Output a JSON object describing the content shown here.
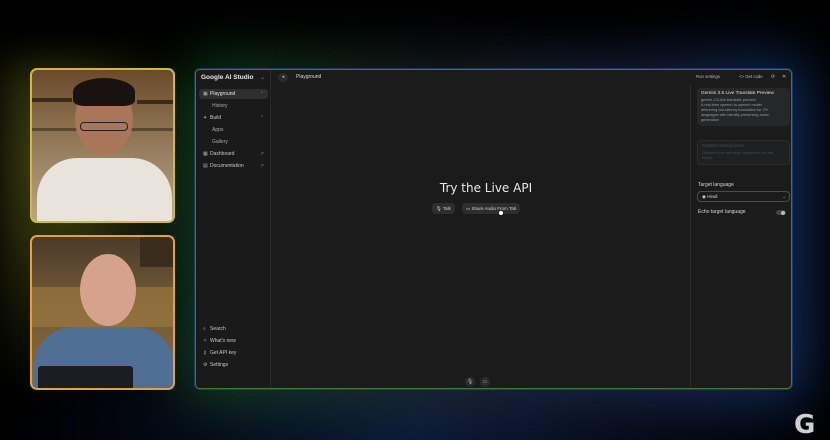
{
  "app": {
    "brand": "Google AI Studio"
  },
  "sidebar": {
    "items": [
      {
        "label": "Playground",
        "icon": "playground-icon"
      },
      {
        "label": "History"
      },
      {
        "label": "Build",
        "icon": "build-icon"
      },
      {
        "label": "Apps"
      },
      {
        "label": "Gallery"
      },
      {
        "label": "Dashboard",
        "icon": "dashboard-icon"
      },
      {
        "label": "Documentation",
        "icon": "documentation-icon"
      }
    ],
    "bottom": [
      {
        "label": "Search",
        "icon": "search-icon"
      },
      {
        "label": "What's new",
        "icon": "sparkle-icon"
      },
      {
        "label": "Get API key",
        "icon": "key-icon"
      },
      {
        "label": "Settings",
        "icon": "gear-icon"
      }
    ]
  },
  "topbar": {
    "title": "Playground",
    "run_settings": "Run settings",
    "get_code": "<> Get code"
  },
  "main": {
    "title": "Try the Live API",
    "talk_label": "Talk",
    "share_label": "Share Audio From Tab"
  },
  "rpanel": {
    "model_card": {
      "title": "Gemini 3.5 Live Translate Preview",
      "lines": [
        "gemini-3.5-live-translate-preview",
        "A real-time speech-to-speech model",
        "delivering low-latency translation for 70+",
        "languages with identity-preserving audio",
        "generation"
      ]
    },
    "instructions_card": {
      "title": "System instructions",
      "lines": [
        "Optional tone and style instructions for the",
        "model"
      ]
    },
    "target_language_label": "Target language",
    "target_language_value": "Hindi",
    "echo_label": "Echo target language"
  },
  "colors": {
    "window_border": "#3f7a3a",
    "accent_blue": "#1d4fa8"
  }
}
